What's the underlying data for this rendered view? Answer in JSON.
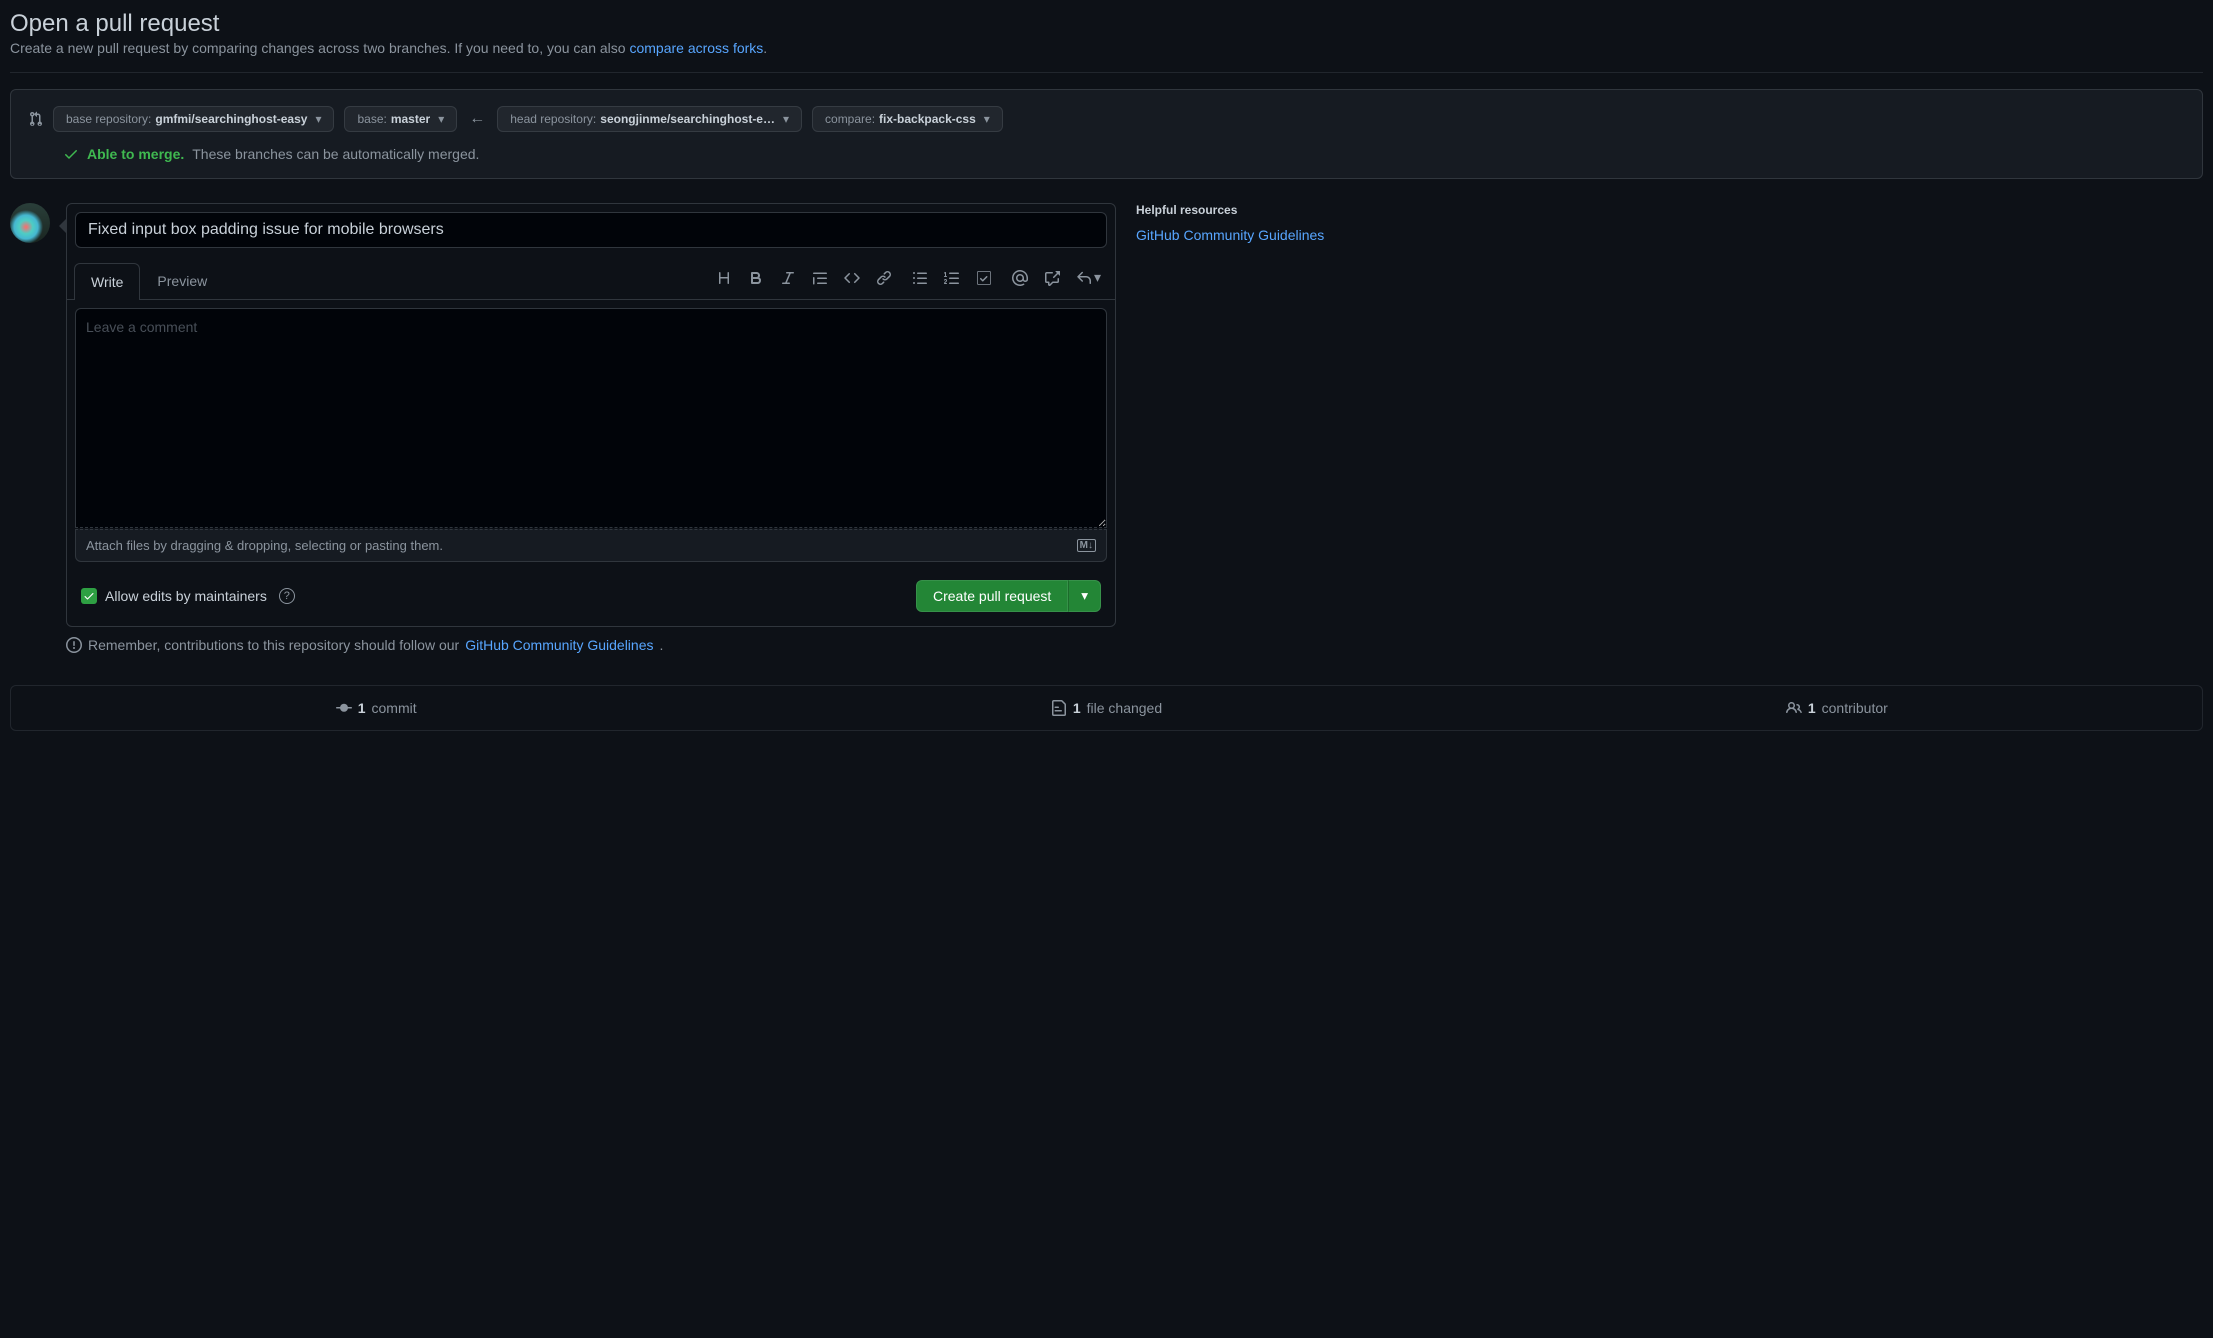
{
  "header": {
    "title": "Open a pull request",
    "subtitle_prefix": "Create a new pull request by comparing changes across two branches. If you need to, you can also ",
    "subtitle_link": "compare across forks",
    "subtitle_suffix": "."
  },
  "range": {
    "base_repo_label": "base repository: ",
    "base_repo_value": "gmfmi/searchinghost-easy",
    "base_branch_label": "base: ",
    "base_branch_value": "master",
    "head_repo_label": "head repository: ",
    "head_repo_value": "seongjinme/searchinghost-e…",
    "compare_label": "compare: ",
    "compare_value": "fix-backpack-css"
  },
  "merge_status": {
    "able": "Able to merge.",
    "desc": "These branches can be automatically merged."
  },
  "form": {
    "title_value": "Fixed input box padding issue for mobile browsers",
    "tabs": {
      "write": "Write",
      "preview": "Preview"
    },
    "comment_placeholder": "Leave a comment",
    "attach_hint": "Attach files by dragging & dropping, selecting or pasting them.",
    "allow_edits_label": "Allow edits by maintainers",
    "allow_edits_checked": true,
    "submit_label": "Create pull request"
  },
  "sidebar": {
    "heading": "Helpful resources",
    "link": "GitHub Community Guidelines"
  },
  "remember": {
    "prefix": "Remember, contributions to this repository should follow our ",
    "link": "GitHub Community Guidelines",
    "suffix": "."
  },
  "stats": {
    "commits_count": "1",
    "commits_label": "commit",
    "files_count": "1",
    "files_label": "file changed",
    "contributors_count": "1",
    "contributors_label": "contributor"
  }
}
